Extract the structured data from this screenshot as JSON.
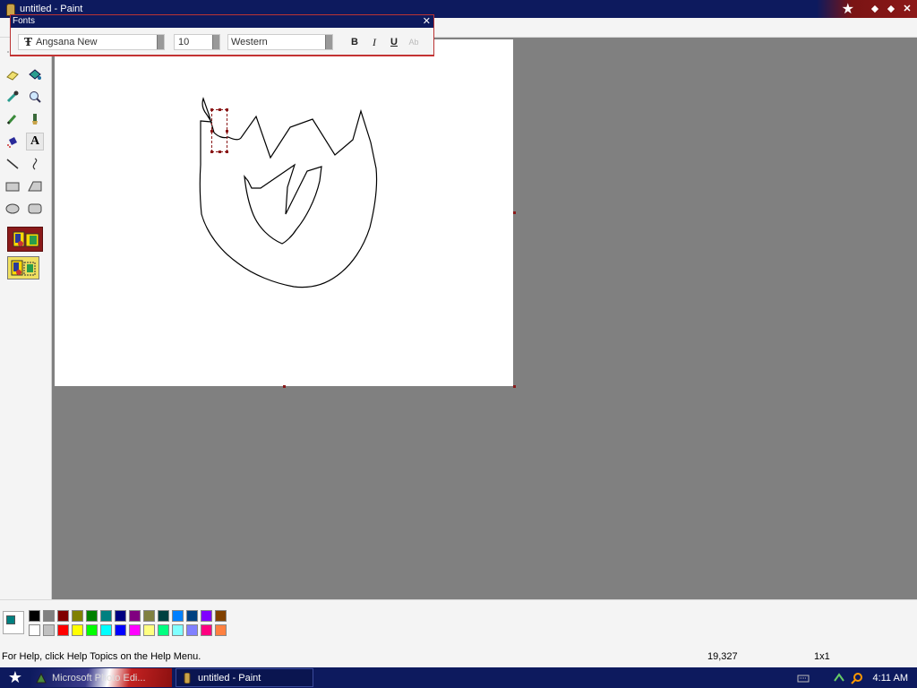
{
  "window": {
    "title": "untitled - Paint",
    "icon": "paint-bucket-icon"
  },
  "title_controls": [
    "star-icon",
    "minimize-icon",
    "maximize-icon",
    "close-icon"
  ],
  "fonts_toolbar": {
    "title": "Fonts",
    "font_name": "Angsana New",
    "font_size": "10",
    "script": "Western",
    "bold_label": "B",
    "italic_label": "I",
    "underline_label": "U",
    "vertical_label": "Ab"
  },
  "tools": [
    {
      "name": "free-form-select-icon"
    },
    {
      "name": "select-icon"
    },
    {
      "name": "eraser-icon"
    },
    {
      "name": "fill-bucket-icon"
    },
    {
      "name": "pick-color-icon"
    },
    {
      "name": "magnifier-icon"
    },
    {
      "name": "pencil-icon"
    },
    {
      "name": "brush-icon"
    },
    {
      "name": "airbrush-icon"
    },
    {
      "name": "text-icon",
      "label": "A"
    },
    {
      "name": "line-icon"
    },
    {
      "name": "curve-icon"
    },
    {
      "name": "rectangle-icon"
    },
    {
      "name": "polygon-icon"
    },
    {
      "name": "ellipse-icon"
    },
    {
      "name": "rounded-rectangle-icon"
    }
  ],
  "text_options": [
    "opaque-background-option",
    "transparent-background-option"
  ],
  "palette": {
    "foreground": "#008080",
    "background": "#ffffff",
    "row1": [
      "#000000",
      "#808080",
      "#800000",
      "#808000",
      "#008000",
      "#008080",
      "#000080",
      "#800080",
      "#808040",
      "#004040",
      "#0080ff",
      "#004080",
      "#8000ff",
      "#804000"
    ],
    "row2": [
      "#ffffff",
      "#c0c0c0",
      "#ff0000",
      "#ffff00",
      "#00ff00",
      "#00ffff",
      "#0000ff",
      "#ff00ff",
      "#ffff80",
      "#00ff80",
      "#80ffff",
      "#8080ff",
      "#ff0080",
      "#ff8040"
    ]
  },
  "status": {
    "help_text": "For Help, click Help Topics on the Help Menu.",
    "coordinates": "19,327",
    "selection_size": "1x1"
  },
  "taskbar": {
    "tasks": [
      {
        "label": "Microsoft Photo Edi...",
        "icon": "photo-editor-icon"
      },
      {
        "label": "untitled - Paint",
        "icon": "paint-bucket-icon"
      }
    ],
    "tray_icons": [
      "keyboard-icon",
      "network-icon",
      "search-icon"
    ],
    "clock": "4:11 AM"
  }
}
